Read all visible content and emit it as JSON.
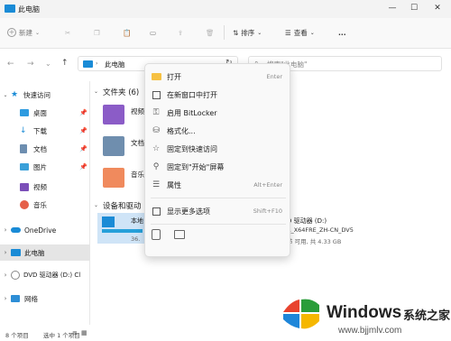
{
  "window": {
    "title": "此电脑"
  },
  "toolbar": {
    "new_label": "新建",
    "sort_label": "排序",
    "view_label": "查看",
    "more_label": "..."
  },
  "address": {
    "path": "此电脑"
  },
  "search": {
    "placeholder": "搜索\"此电脑\""
  },
  "sidebar": {
    "items": [
      {
        "label": "快速访问"
      },
      {
        "label": "桌面"
      },
      {
        "label": "下载"
      },
      {
        "label": "文档"
      },
      {
        "label": "图片"
      },
      {
        "label": "视频"
      },
      {
        "label": "音乐"
      },
      {
        "label": "OneDrive"
      },
      {
        "label": "此电脑"
      },
      {
        "label": "DVD 驱动器 (D:) Cl"
      },
      {
        "label": "网络"
      }
    ]
  },
  "content": {
    "folders_header": "文件夹 (6)",
    "folder_names": [
      "视频",
      "文档",
      "音乐"
    ],
    "devices_header": "设备和驱动",
    "drive_c": {
      "name": "本地",
      "free": "36."
    },
    "drive_d": {
      "name": "D 驱动器 (D:)",
      "label": "A_X64FRE_ZH-CN_DV5",
      "free": "节 可用, 共 4.33 GB"
    }
  },
  "context_menu": {
    "items": [
      {
        "label": "打开",
        "shortcut": "Enter"
      },
      {
        "label": "在新窗口中打开",
        "shortcut": ""
      },
      {
        "label": "启用 BitLocker",
        "shortcut": ""
      },
      {
        "label": "格式化...",
        "shortcut": ""
      },
      {
        "label": "固定到快速访问",
        "shortcut": ""
      },
      {
        "label": "固定到\"开始\"屏幕",
        "shortcut": ""
      },
      {
        "label": "属性",
        "shortcut": "Alt+Enter"
      },
      {
        "label": "显示更多选项",
        "shortcut": "Shift+F10"
      }
    ]
  },
  "status": {
    "count": "8 个项目",
    "selected": "选中 1 个项目"
  },
  "watermark": {
    "brand": "Windows",
    "cn": "系统之家",
    "url": "www.bjjmlv.com"
  },
  "colors": {
    "accent": "#0078d4",
    "folder": "#f6c143"
  }
}
